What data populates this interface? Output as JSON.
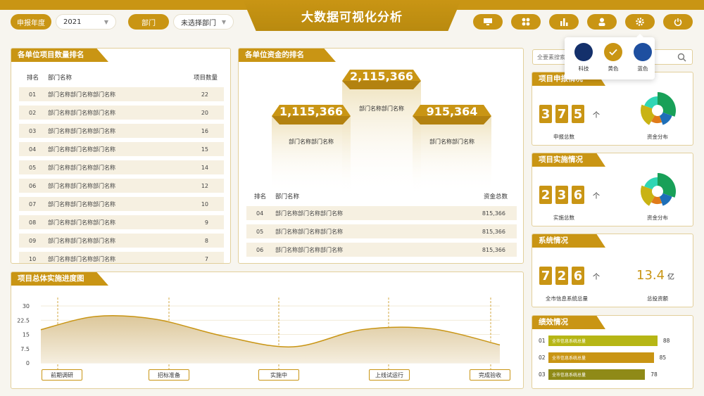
{
  "header": {
    "title": "大数据可视化分析",
    "year_label": "申报年度",
    "year_value": "2021",
    "dept_label": "部门",
    "dept_value": "未选择部门"
  },
  "theme": {
    "items": [
      {
        "label": "科技",
        "color": "#14306b"
      },
      {
        "label": "黄色",
        "color": "#c99514"
      },
      {
        "label": "蓝色",
        "color": "#1e4fa0"
      }
    ]
  },
  "search": {
    "placeholder": "全要素搜索"
  },
  "project_rank": {
    "title": "各单位项目数量排名",
    "col_rank": "排名",
    "col_name": "部门名称",
    "col_count": "项目数量",
    "rows": [
      {
        "rank": "01",
        "name": "部门名称部门名称部门名称",
        "count": "22"
      },
      {
        "rank": "02",
        "name": "部门名称部门名称部门名称",
        "count": "20"
      },
      {
        "rank": "03",
        "name": "部门名称部门名称部门名称",
        "count": "16"
      },
      {
        "rank": "04",
        "name": "部门名称部门名称部门名称",
        "count": "15"
      },
      {
        "rank": "05",
        "name": "部门名称部门名称部门名称",
        "count": "14"
      },
      {
        "rank": "06",
        "name": "部门名称部门名称部门名称",
        "count": "12"
      },
      {
        "rank": "07",
        "name": "部门名称部门名称部门名称",
        "count": "10"
      },
      {
        "rank": "08",
        "name": "部门名称部门名称部门名称",
        "count": "9"
      },
      {
        "rank": "09",
        "name": "部门名称部门名称部门名称",
        "count": "8"
      },
      {
        "rank": "10",
        "name": "部门名称部门名称部门名称",
        "count": "7"
      }
    ]
  },
  "fund_rank": {
    "title": "各单位资金的排名",
    "podium": [
      {
        "value": "2,115,366",
        "name": "部门名称部门名称"
      },
      {
        "value": "1,115,366",
        "name": "部门名称部门名称"
      },
      {
        "value": "915,364",
        "name": "部门名称部门名称"
      }
    ],
    "col_rank": "排名",
    "col_name": "部门名称",
    "col_total": "资金总数",
    "rows": [
      {
        "rank": "04",
        "name": "部门名称部门名称部门名称",
        "total": "815,366"
      },
      {
        "rank": "05",
        "name": "部门名称部门名称部门名称",
        "total": "815,366"
      },
      {
        "rank": "06",
        "name": "部门名称部门名称部门名称",
        "total": "815,366"
      }
    ]
  },
  "progress": {
    "title": "项目总体实施进度图",
    "stages": [
      "前期调研",
      "招标准备",
      "实施中",
      "上线试运行",
      "完成验收"
    ]
  },
  "chart_data": {
    "type": "area",
    "title": "项目总体实施进度图",
    "categories": [
      "前期调研",
      "招标准备",
      "实施中",
      "上线试运行",
      "完成验收"
    ],
    "y_ticks": [
      "30",
      "22.5",
      "15",
      "7.5",
      "0"
    ],
    "ylim": [
      0,
      30
    ],
    "x": [
      0,
      0.12,
      0.25,
      0.4,
      0.55,
      0.7,
      0.85,
      1.0
    ],
    "values": [
      17.5,
      24.5,
      23,
      14,
      8.5,
      17.5,
      18,
      9.5
    ]
  },
  "declare": {
    "title": "项目申报情况",
    "digits": [
      "3",
      "7",
      "5"
    ],
    "unit": "个",
    "count_label": "申报总数",
    "dist_label": "资金分布"
  },
  "implement": {
    "title": "项目实施情况",
    "digits": [
      "2",
      "3",
      "6"
    ],
    "unit": "个",
    "count_label": "实施总数",
    "dist_label": "资金分布"
  },
  "system": {
    "title": "系统情况",
    "digits": [
      "7",
      "2",
      "6"
    ],
    "unit": "个",
    "count_label": "全市信息系统总量",
    "invest_value": "13.4",
    "invest_unit": "亿",
    "invest_label": "总投资额"
  },
  "performance": {
    "title": "绩效情况",
    "bars": [
      {
        "index": "01",
        "label": "全市信息系统总量",
        "value": 88,
        "value_text": "88",
        "color": "#b6b615"
      },
      {
        "index": "02",
        "label": "全市信息系统总量",
        "value": 85,
        "value_text": "85",
        "color": "#c99514"
      },
      {
        "index": "03",
        "label": "全市信息系统总量",
        "value": 78,
        "value_text": "78",
        "color": "#8f8a17"
      }
    ]
  }
}
